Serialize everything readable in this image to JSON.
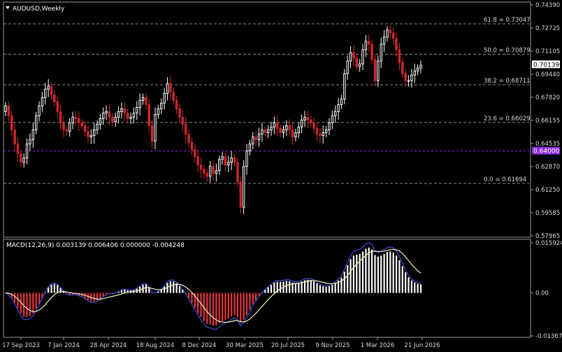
{
  "chart_data": [
    {
      "type": "candlestick",
      "title": "AUDUSD,Weekly",
      "price_axis_ticks": [
        "0.74390",
        "0.72725",
        "0.71105",
        "0.69440",
        "0.67820",
        "0.66155",
        "0.64535",
        "0.62870",
        "0.61250",
        "0.59585",
        "0.57965"
      ],
      "ylim": [
        0.57965,
        0.7439
      ],
      "x_labels": [
        "17 Sep 2023",
        "7 Jan 2024",
        "28 Apr 2024",
        "18 Aug 2024",
        "8 Dec 2024",
        "30 Mar 2025",
        "20 Jul 2025",
        "9 Nov 2025",
        "1 Mar 2026",
        "21 Jun 2026"
      ],
      "fibonacci": [
        {
          "label": "61.8 = 0.73047",
          "value": 0.73047
        },
        {
          "label": "50.0 = 0.70879",
          "value": 0.70879
        },
        {
          "label": "38.2 = 0.68711",
          "value": 0.68711
        },
        {
          "label": "23.6 = 0.66029",
          "value": 0.66029
        },
        {
          "label": "0.0 = 0.61694",
          "value": 0.61694
        }
      ],
      "current_price": "0.70139",
      "level_line": {
        "label": "0.64000",
        "value": 0.64
      },
      "colors": {
        "bull": "#ffffff",
        "bear": "#d0262b",
        "fib": "#8a8a8a",
        "level": "#8a2be2",
        "current": "#ffffff"
      },
      "close_series": [
        0.672,
        0.665,
        0.655,
        0.645,
        0.638,
        0.632,
        0.635,
        0.645,
        0.648,
        0.655,
        0.665,
        0.672,
        0.678,
        0.684,
        0.686,
        0.68,
        0.675,
        0.668,
        0.66,
        0.655,
        0.654,
        0.66,
        0.664,
        0.663,
        0.66,
        0.658,
        0.654,
        0.65,
        0.651,
        0.655,
        0.659,
        0.663,
        0.667,
        0.668,
        0.664,
        0.661,
        0.664,
        0.668,
        0.67,
        0.667,
        0.663,
        0.664,
        0.667,
        0.671,
        0.676,
        0.678,
        0.673,
        0.658,
        0.647,
        0.666,
        0.67,
        0.674,
        0.681,
        0.688,
        0.682,
        0.676,
        0.67,
        0.664,
        0.659,
        0.652,
        0.646,
        0.641,
        0.636,
        0.63,
        0.627,
        0.624,
        0.622,
        0.629,
        0.624,
        0.626,
        0.634,
        0.636,
        0.63,
        0.632,
        0.635,
        0.632,
        0.618,
        0.6,
        0.629,
        0.64,
        0.645,
        0.65,
        0.648,
        0.652,
        0.655,
        0.653,
        0.655,
        0.657,
        0.66,
        0.656,
        0.653,
        0.655,
        0.658,
        0.655,
        0.65,
        0.653,
        0.657,
        0.662,
        0.664,
        0.662,
        0.66,
        0.656,
        0.652,
        0.651,
        0.653,
        0.655,
        0.66,
        0.665,
        0.668,
        0.673,
        0.677,
        0.695,
        0.704,
        0.71,
        0.706,
        0.7,
        0.702,
        0.712,
        0.718,
        0.716,
        0.705,
        0.69,
        0.704,
        0.716,
        0.721,
        0.726,
        0.724,
        0.72,
        0.712,
        0.703,
        0.695,
        0.69,
        0.69,
        0.694,
        0.697,
        0.699,
        0.701
      ],
      "macd": {
        "label": "MACD(12,26,9) 0.003139 0.006406 0.000000 -0.004248",
        "ylim": [
          -0.013677,
          0.015924
        ],
        "axis_ticks": [
          "0.015924",
          "0.00",
          "-0.013677"
        ],
        "colors": {
          "hist_pos": "#ffffff",
          "hist_neg": "#e8343a",
          "macd": "#3b4fe0",
          "signal": "#f4f1c0"
        }
      }
    }
  ]
}
